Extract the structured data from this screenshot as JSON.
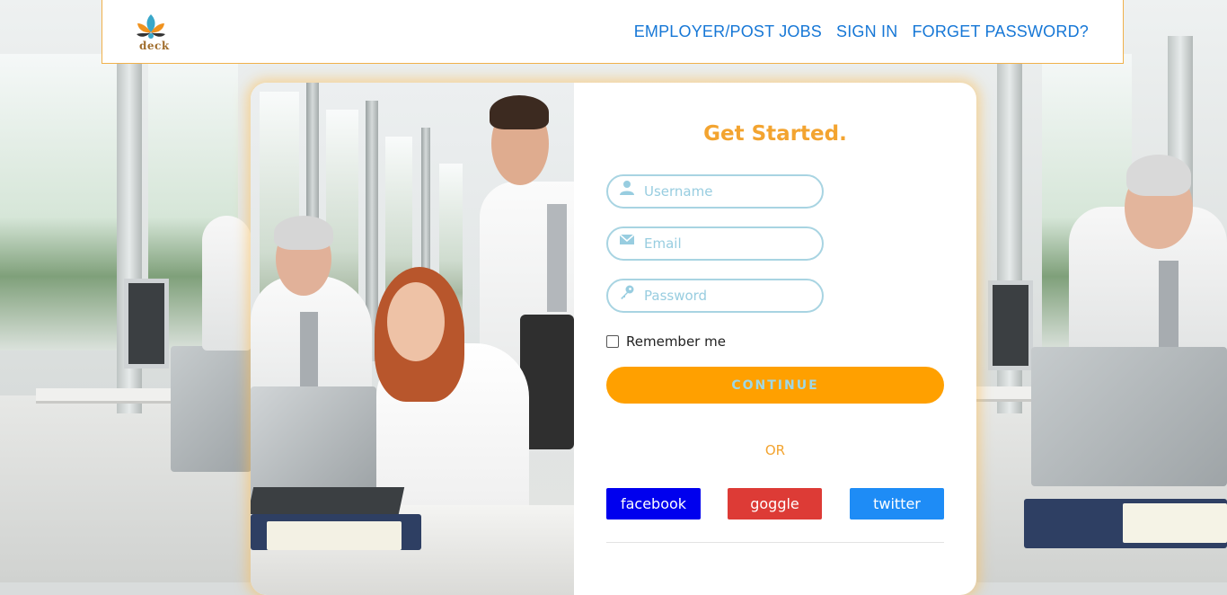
{
  "header": {
    "logo_text": "deck",
    "nav": [
      "EMPLOYER/POST JOBS",
      "SIGN IN",
      "FORGET PASSWORD?"
    ]
  },
  "form": {
    "title": "Get Started.",
    "username": {
      "placeholder": "Username",
      "value": "",
      "icon": "user-icon"
    },
    "email": {
      "placeholder": "Email",
      "value": "",
      "icon": "envelope-icon"
    },
    "password": {
      "placeholder": "Password",
      "value": "",
      "icon": "key-icon"
    },
    "remember_label": "Remember me",
    "remember_checked": false,
    "continue_label": "CONTINUE",
    "or_label": "OR",
    "social": [
      {
        "label": "facebook",
        "color": "#0000ee"
      },
      {
        "label": "goggle",
        "color": "#dd3b36"
      },
      {
        "label": "twitter",
        "color": "#1e8cf6"
      }
    ]
  },
  "colors": {
    "accent_orange": "#ffa000",
    "title_orange": "#f3a430",
    "nav_blue": "#1677d6",
    "field_border": "#a8d4e2"
  }
}
